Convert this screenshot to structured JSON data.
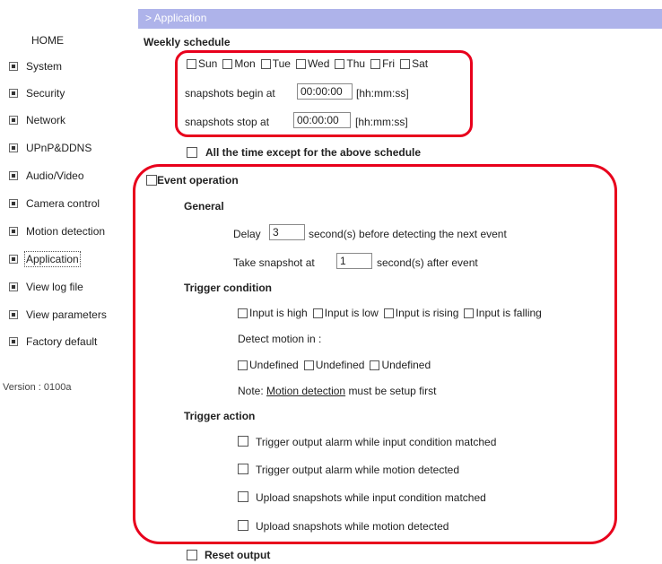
{
  "sidebar": {
    "home": "HOME",
    "items": [
      {
        "label": "System"
      },
      {
        "label": "Security"
      },
      {
        "label": "Network"
      },
      {
        "label": "UPnP&DDNS"
      },
      {
        "label": "Audio/Video"
      },
      {
        "label": "Camera control"
      },
      {
        "label": "Motion detection"
      },
      {
        "label": "Application"
      },
      {
        "label": "View log file"
      },
      {
        "label": "View parameters"
      },
      {
        "label": "Factory default"
      }
    ],
    "current": "Application",
    "version": "Version : 0100a"
  },
  "header": {
    "title": "> Application"
  },
  "weekly": {
    "title": "Weekly schedule",
    "days": [
      "Sun",
      "Mon",
      "Tue",
      "Wed",
      "Thu",
      "Fri",
      "Sat"
    ],
    "begin_label": "snapshots begin at",
    "begin_value": "00:00:00",
    "begin_hint": "[hh:mm:ss]",
    "stop_label": "snapshots stop at",
    "stop_value": "00:00:00",
    "stop_hint": "[hh:mm:ss]",
    "except_label": "All the time except for the above schedule"
  },
  "event": {
    "title": "Event operation",
    "general_title": "General",
    "delay_label": "Delay",
    "delay_value": "3",
    "delay_suffix": "second(s) before detecting the next event",
    "snapshot_label": "Take snapshot at",
    "snapshot_value": "1",
    "snapshot_suffix": "second(s) after event",
    "trigger_condition_title": "Trigger condition",
    "trigger_options": [
      "Input is high",
      "Input is low",
      "Input is rising",
      "Input is falling"
    ],
    "detect_motion_label": "Detect motion in :",
    "motion_windows": [
      "Undefined",
      "Undefined",
      "Undefined"
    ],
    "note_prefix": "Note:",
    "note_link": "Motion detection",
    "note_suffix": "must be setup first",
    "trigger_action_title": "Trigger action",
    "actions": [
      "Trigger output alarm while input condition matched",
      "Trigger output alarm while motion detected",
      "Upload snapshots while input condition matched",
      "Upload snapshots while motion detected"
    ],
    "reset_output": "Reset output"
  },
  "colors": {
    "header_bar": "#aeb3ea",
    "annotation": "#e8001c"
  }
}
